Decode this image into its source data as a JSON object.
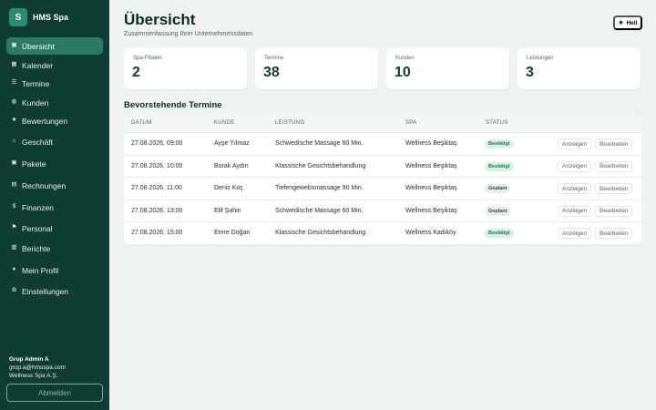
{
  "app": {
    "logo_letter": "S",
    "name": "HMS Spa"
  },
  "nav": [
    {
      "label": "Übersicht",
      "icon": "▣",
      "icon_name": "dashboard-icon",
      "active": true
    },
    {
      "label": "Kalender",
      "icon": "▦",
      "icon_name": "calendar-icon"
    },
    {
      "label": "Termine",
      "icon": "☰",
      "icon_name": "list-icon"
    },
    {
      "label": "Kunden",
      "icon": "◍",
      "icon_name": "users-icon"
    },
    {
      "label": "Bewertungen",
      "icon": "★",
      "icon_name": "star-icon"
    },
    {
      "label": "Geschäft",
      "icon": "⌂",
      "icon_name": "store-icon"
    },
    {
      "label": "Pakete",
      "icon": "▣",
      "icon_name": "package-icon"
    },
    {
      "label": "Rechnungen",
      "icon": "▤",
      "icon_name": "invoice-icon"
    },
    {
      "label": "Finanzen",
      "icon": "$",
      "icon_name": "money-bag-icon"
    },
    {
      "label": "Personal",
      "icon": "⚑",
      "icon_name": "flag-icon"
    },
    {
      "label": "Berichte",
      "icon": "▥",
      "icon_name": "chart-icon"
    },
    {
      "label": "Mein Profil",
      "icon": "●",
      "icon_name": "profile-icon"
    },
    {
      "label": "Einstellungen",
      "icon": "⚙",
      "icon_name": "gear-icon"
    }
  ],
  "user": {
    "name": "Grup Admin A",
    "email": "grup.a@hmsspa.com",
    "company": "Wellness Spa A.Ş."
  },
  "logout_label": "Abmelden",
  "header": {
    "title": "Übersicht",
    "subtitle": "Zusammenfassung Ihrer Unternehmensdaten"
  },
  "theme": {
    "icon": "☀",
    "label": "Hell"
  },
  "stats": [
    {
      "label": "Spa-Filialen",
      "value": "2"
    },
    {
      "label": "Termine",
      "value": "38"
    },
    {
      "label": "Kunden",
      "value": "10"
    },
    {
      "label": "Leistungen",
      "value": "3"
    }
  ],
  "appointments": {
    "title": "Bevorstehende Termine",
    "columns": [
      "DATUM",
      "KUNDE",
      "LEISTUNG",
      "SPA",
      "STATUS"
    ],
    "view_label": "Anzeigen",
    "edit_label": "Bearbeiten",
    "rows": [
      {
        "date": "27.08.2026, 09:00",
        "customer": "Ayşe Yılmaz",
        "service": "Schwedische Massage 60 Min.",
        "spa": "Wellness Beşiktaş",
        "status": "Bestätigt",
        "status_type": "ok"
      },
      {
        "date": "27.08.2026, 10:00",
        "customer": "Burak Aydın",
        "service": "Klassische Gesichtsbehandlung",
        "spa": "Wellness Beşiktaş",
        "status": "Bestätigt",
        "status_type": "ok"
      },
      {
        "date": "27.08.2026, 11:00",
        "customer": "Deniz Koç",
        "service": "Tiefengewebsmassage 90 Min.",
        "spa": "Wellness Beşiktaş",
        "status": "Geplant",
        "status_type": "plan"
      },
      {
        "date": "27.08.2026, 13:00",
        "customer": "Elif Şahin",
        "service": "Schwedische Massage 60 Min.",
        "spa": "Wellness Beşiktaş",
        "status": "Geplant",
        "status_type": "plan"
      },
      {
        "date": "27.08.2026, 15:00",
        "customer": "Emre Doğan",
        "service": "Klassische Gesichtsbehandlung",
        "spa": "Wellness Kadıköy",
        "status": "Bestätigt",
        "status_type": "ok"
      }
    ]
  },
  "colors": {
    "sidebar": "#0f3d33",
    "active": "#2a7a66",
    "accent": "#2e8b73",
    "background": "#eef3f1"
  }
}
